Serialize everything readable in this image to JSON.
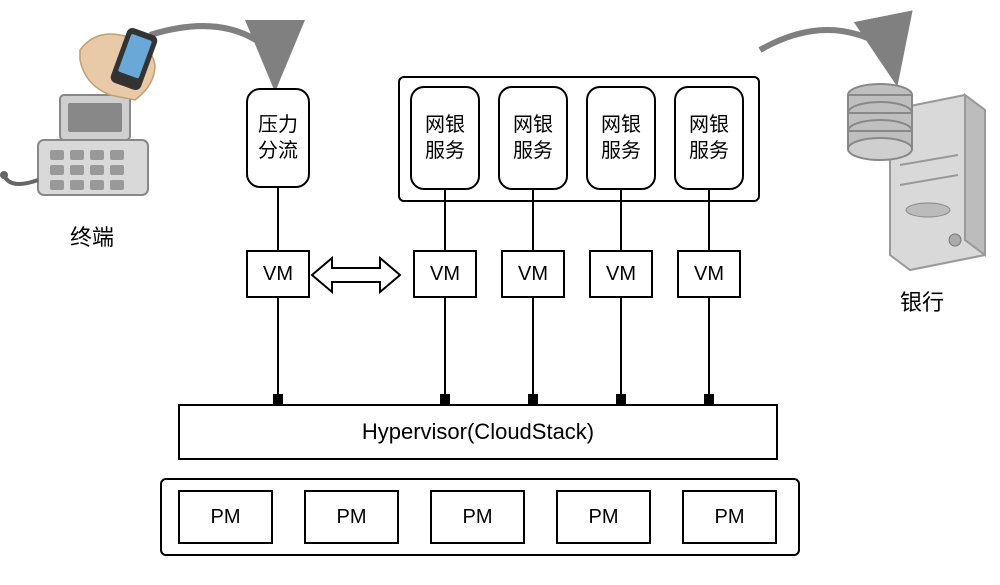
{
  "terminal_label": "终端",
  "bank_label": "银行",
  "pressure_box": "压力\n分流",
  "service_boxes": [
    "网银\n服务",
    "网银\n服务",
    "网银\n服务",
    "网银\n服务"
  ],
  "vm_label": "VM",
  "hypervisor_label": "Hypervisor(CloudStack)",
  "pm_label": "PM"
}
